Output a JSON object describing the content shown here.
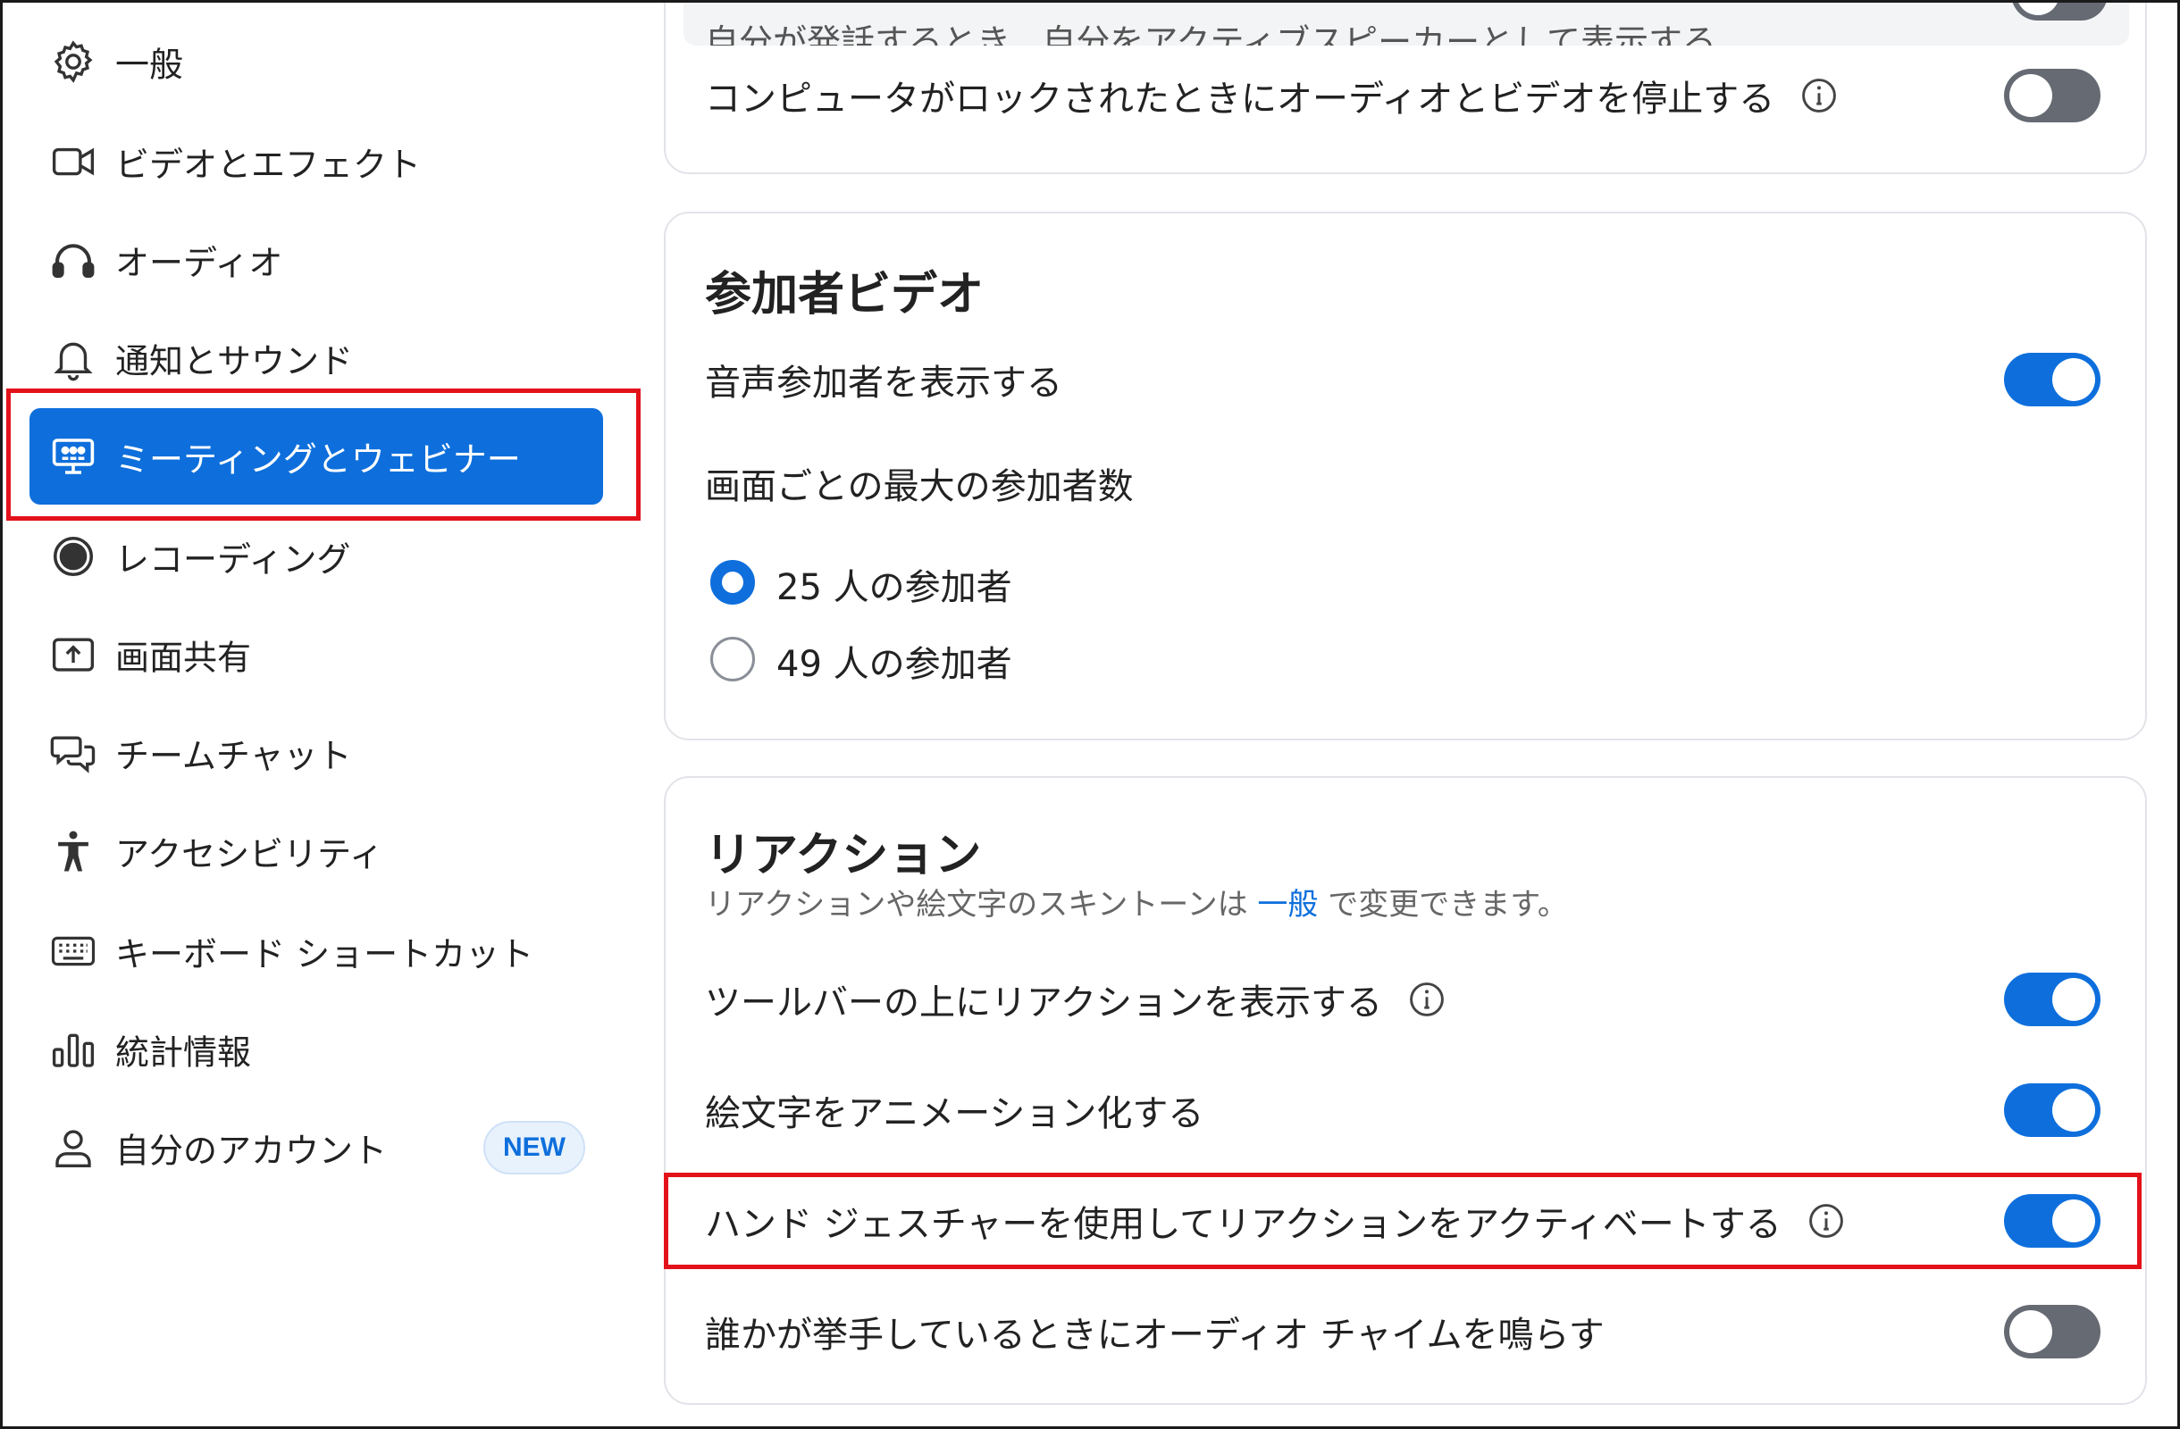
{
  "sidebar": {
    "items": [
      {
        "label": "一般",
        "icon": "gear-icon"
      },
      {
        "label": "ビデオとエフェクト",
        "icon": "video-camera-icon"
      },
      {
        "label": "オーディオ",
        "icon": "headphones-icon"
      },
      {
        "label": "通知とサウンド",
        "icon": "bell-icon"
      },
      {
        "label": "ミーティングとウェビナー",
        "icon": "meeting-screen-icon",
        "active": true
      },
      {
        "label": "レコーディング",
        "icon": "record-icon"
      },
      {
        "label": "画面共有",
        "icon": "share-screen-icon"
      },
      {
        "label": "チームチャット",
        "icon": "chat-bubbles-icon"
      },
      {
        "label": "アクセシビリティ",
        "icon": "accessibility-icon"
      },
      {
        "label": "キーボード ショートカット",
        "icon": "keyboard-icon"
      },
      {
        "label": "統計情報",
        "icon": "bar-chart-icon"
      },
      {
        "label": "自分のアカウント",
        "icon": "user-icon",
        "badge": "NEW"
      }
    ]
  },
  "top_card": {
    "clipped_text": "自分が発話するとき、自分をアクティブスピーカーとして表示する",
    "row_lock": {
      "label": "コンピュータがロックされたときにオーディオとビデオを停止する",
      "toggle": "off"
    }
  },
  "participant_video": {
    "title": "参加者ビデオ",
    "show_audio_participants": {
      "label": "音声参加者を表示する",
      "toggle": "on"
    },
    "max_participants_label": "画面ごとの最大の参加者数",
    "options": [
      {
        "label": "25 人の参加者",
        "checked": true
      },
      {
        "label": "49 人の参加者",
        "checked": false
      }
    ]
  },
  "reactions": {
    "title": "リアクション",
    "subtitle_pre": "リアクションや絵文字のスキントーンは",
    "subtitle_link": "一般",
    "subtitle_post": "で変更できます。",
    "rows": [
      {
        "label": "ツールバーの上にリアクションを表示する",
        "info": true,
        "toggle": "on"
      },
      {
        "label": "絵文字をアニメーション化する",
        "info": false,
        "toggle": "on"
      },
      {
        "label": "ハンド ジェスチャーを使用してリアクションをアクティベートする",
        "info": true,
        "toggle": "on"
      },
      {
        "label": "誰かが挙手しているときにオーディオ チャイムを鳴らす",
        "info": false,
        "toggle": "off"
      }
    ]
  },
  "colors": {
    "accent": "#0e6fdc",
    "highlight_box": "#e3111a",
    "toggle_off": "#656a73"
  }
}
